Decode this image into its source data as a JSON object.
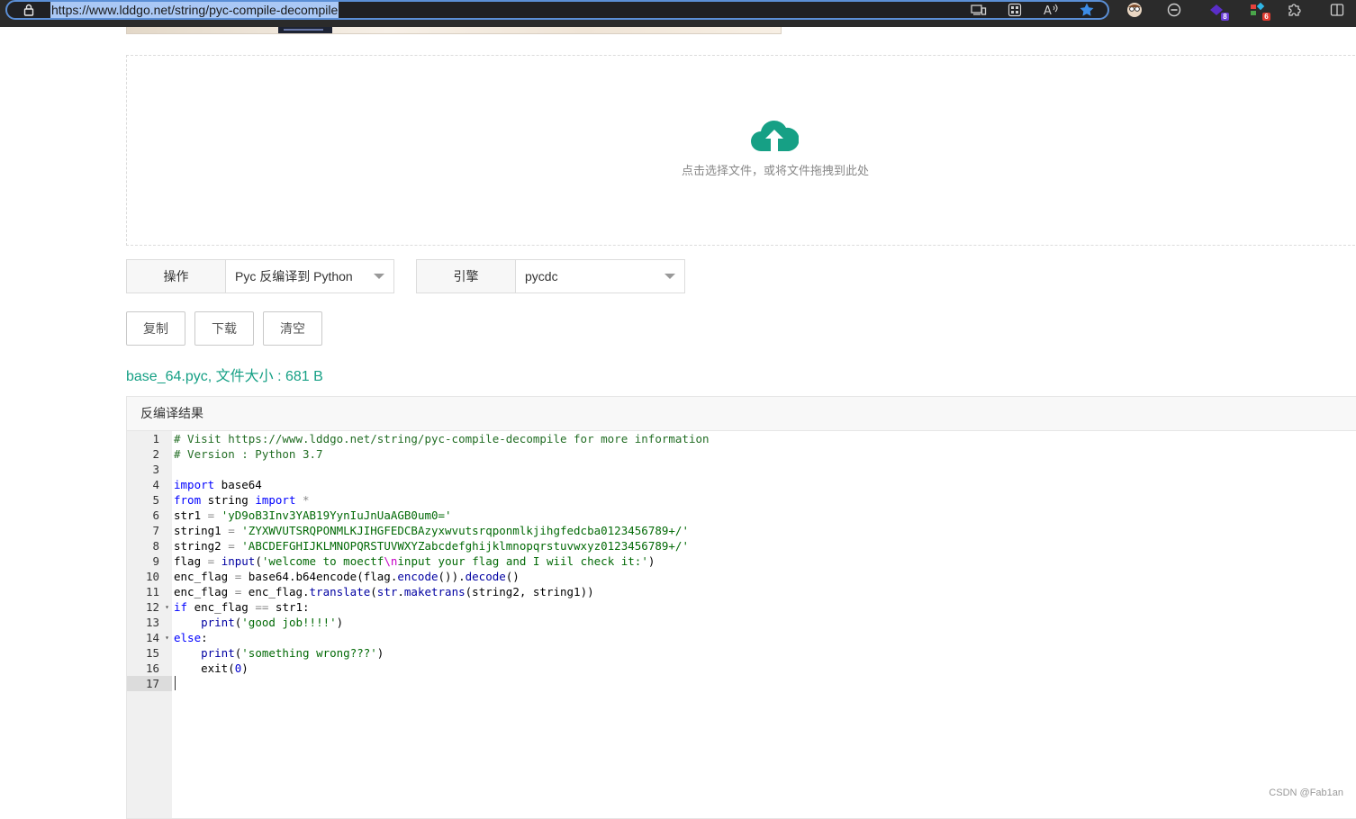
{
  "browser": {
    "url": "https://www.lddgo.net/string/pyc-compile-decompile",
    "toolbar_icons": [
      "lock-icon",
      "devices-icon",
      "apps-grid-icon",
      "read-aloud-icon",
      "favorite-star-icon",
      "profile-avatar-icon",
      "blocker-icon",
      "extension-purple-icon",
      "extension-colorful-icon",
      "extensions-puzzle-icon",
      "split-screen-icon"
    ],
    "badges": {
      "extension_purple": "8",
      "extension_colorful": "6"
    },
    "colors": {
      "bar": "#2b2b2b",
      "url_highlight": "#aac8f5",
      "star": "#3c8ce7"
    }
  },
  "upload": {
    "hint": "点击选择文件，或将文件拖拽到此处",
    "icon": "cloud-upload-icon",
    "icon_color": "#16a085"
  },
  "options": {
    "operation_label": "操作",
    "operation_value": "Pyc 反编译到 Python",
    "engine_label": "引擎",
    "engine_value": "pycdc"
  },
  "actions": {
    "copy_label": "复制",
    "download_label": "下载",
    "clear_label": "清空"
  },
  "file_info": "base_64.pyc, 文件大小 : 681 B",
  "result": {
    "title": "反编译结果",
    "line_numbers": [
      "1",
      "2",
      "3",
      "4",
      "5",
      "6",
      "7",
      "8",
      "9",
      "10",
      "11",
      "12",
      "13",
      "14",
      "15",
      "16",
      "17"
    ],
    "code_lines": [
      "# Visit https://www.lddgo.net/string/pyc-compile-decompile for more information",
      "# Version : Python 3.7",
      "",
      "import base64",
      "from string import *",
      "str1 = 'yD9oB3Inv3YAB19YynIuJnUaAGB0um0='",
      "string1 = 'ZYXWVUTSRQPONMLKJIHGFEDCBAzyxwvutsrqponmlkjihgfedcba0123456789+/'",
      "string2 = 'ABCDEFGHIJKLMNOPQRSTUVWXYZabcdefghijklmnopqrstuvwxyz0123456789+/'",
      "flag = input('welcome to moectf\\ninput your flag and I wiil check it:')",
      "enc_flag = base64.b64encode(flag.encode()).decode()",
      "enc_flag = enc_flag.translate(str.maketrans(string2, string1))",
      "if enc_flag == str1:",
      "    print('good job!!!!')",
      "else:",
      "    print('something wrong???')",
      "    exit(0)",
      ""
    ],
    "code_parts": {
      "l1": "# Visit https://www.lddgo.net/string/pyc-compile-decompile for more information",
      "l2": "# Version : Python 3.7",
      "l4_kw": "import",
      "l4_rest": " base64",
      "l5_kw1": "from",
      "l5_mid": " string ",
      "l5_kw2": "import",
      "l5_op": " *",
      "l6_name": "str1 ",
      "l6_op": "=",
      "l6_str": " 'yD9oB3Inv3YAB19YynIuJnUaAGB0um0='",
      "l7_name": "string1 ",
      "l7_op": "=",
      "l7_str": " 'ZYXWVUTSRQPONMLKJIHGFEDCBAzyxwvutsrqponmlkjihgfedcba0123456789+/'",
      "l8_name": "string2 ",
      "l8_op": "=",
      "l8_str": " 'ABCDEFGHIJKLMNOPQRSTUVWXYZabcdefghijklmnopqrstuvwxyz0123456789+/'",
      "l9_name": "flag ",
      "l9_op": "=",
      "l9_sp": " ",
      "l9_fn": "input",
      "l9_p1": "(",
      "l9_s1": "'welcome to moectf",
      "l9_esc": "\\n",
      "l9_s2": "input your flag and I wiil check it:'",
      "l9_p2": ")",
      "l10_a": "enc_flag ",
      "l10_op": "=",
      "l10_b": " base64.b64encode(flag.",
      "l10_fn1": "encode",
      "l10_c": "()).",
      "l10_fn2": "decode",
      "l10_d": "()",
      "l11_a": "enc_flag ",
      "l11_op": "=",
      "l11_b": " enc_flag.",
      "l11_fn1": "translate",
      "l11_c": "(",
      "l11_fn2": "str",
      "l11_d": ".",
      "l11_fn3": "maketrans",
      "l11_e": "(string2, string1))",
      "l12_kw": "if",
      "l12_a": " enc_flag ",
      "l12_op": "==",
      "l12_b": " str1:",
      "l13_ind": "    ",
      "l13_fn": "print",
      "l13_p1": "(",
      "l13_s": "'good job!!!!'",
      "l13_p2": ")",
      "l14_kw": "else",
      "l14_b": ":",
      "l15_ind": "    ",
      "l15_fn": "print",
      "l15_p1": "(",
      "l15_s": "'something wrong???'",
      "l15_p2": ")",
      "l16_ind": "    ",
      "l16_a": "exit(",
      "l16_n": "0",
      "l16_b": ")"
    }
  },
  "watermark": "CSDN @Fab1an"
}
